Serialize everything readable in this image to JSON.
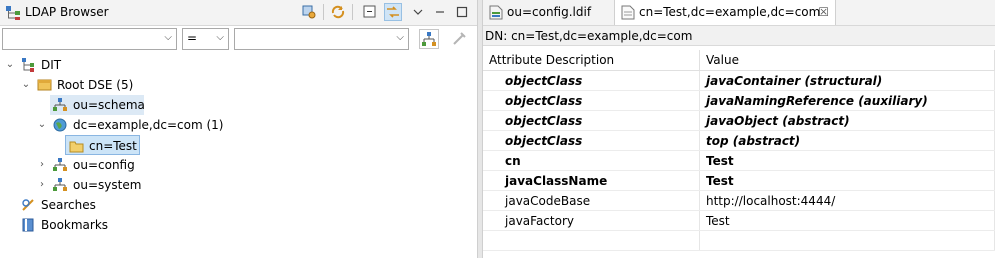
{
  "left_view": {
    "title": "LDAP Browser",
    "toolbar": {
      "icons": [
        "link-with-editor-icon",
        "refresh-icon",
        "collapse-all-icon",
        "link-icon",
        "minimize-icon",
        "maximize-icon"
      ]
    },
    "filter": {
      "attribute_value": "",
      "operator_value": "=",
      "value_value": ""
    },
    "tree": {
      "root_label": "DIT",
      "root_dse_label": "Root DSE (5)",
      "schema_label": "ou=schema",
      "example_label": "dc=example,dc=com (1)",
      "cn_test_label": "cn=Test",
      "config_label": "ou=config",
      "system_label": "ou=system",
      "searches_label": "Searches",
      "bookmarks_label": "Bookmarks"
    }
  },
  "editor": {
    "tabs": [
      {
        "label": "ou=config.ldif"
      },
      {
        "label": "cn=Test,dc=example,dc=com"
      }
    ],
    "close_glyph": "☒",
    "dn_label": "DN: cn=Test,dc=example,dc=com",
    "columns": {
      "description": "Attribute Description",
      "value": "Value"
    },
    "rows": [
      {
        "attr": "objectClass",
        "value": "javaContainer (structural)"
      },
      {
        "attr": "objectClass",
        "value": "javaNamingReference (auxiliary)"
      },
      {
        "attr": "objectClass",
        "value": "javaObject (abstract)"
      },
      {
        "attr": "objectClass",
        "value": "top (abstract)"
      },
      {
        "attr": "cn",
        "value": "Test"
      },
      {
        "attr": "javaClassName",
        "value": "Test"
      },
      {
        "attr": "javaCodeBase",
        "value": "http://localhost:4444/"
      },
      {
        "attr": "javaFactory",
        "value": "Test"
      }
    ]
  }
}
